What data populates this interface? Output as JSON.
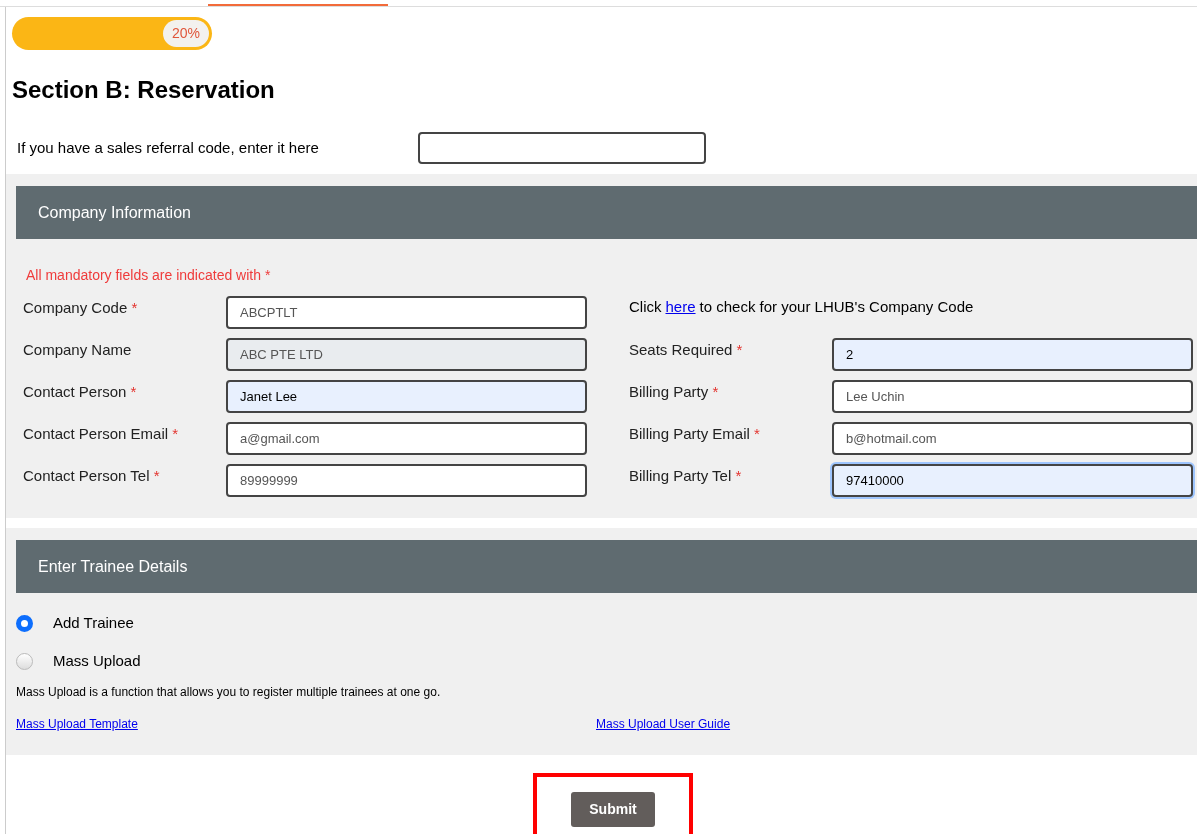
{
  "progress": {
    "level": 0.2,
    "label": "20%"
  },
  "title": "Section B: Reservation",
  "referral": {
    "label": "If you have a sales referral code, enter it here"
  },
  "company_section": {
    "header": "Company Information",
    "note": "All mandatory fields are indicated with *",
    "lookup": {
      "before": "Click",
      "link": "here",
      "after": "to check for your LHUB's Company Code"
    },
    "left_fields": [
      {
        "label": "Company Code",
        "mark": "*",
        "value": "ABCPTLT",
        "disabled": false,
        "autofilled": false,
        "focused": false
      },
      {
        "label": "Company Name",
        "value": "ABC PTE LTD",
        "disabled": true,
        "autofilled": false,
        "focused": false
      },
      {
        "label": "Contact Person",
        "mark": "*",
        "value": "Janet Lee",
        "disabled": false,
        "autofilled": true,
        "focused": false
      },
      {
        "label": "Contact Person Email",
        "mark": "*",
        "value": "a@gmail.com",
        "disabled": false,
        "autofilled": false,
        "focused": false
      },
      {
        "label": "Contact Person Tel",
        "mark": "*",
        "value": "89999999",
        "disabled": false,
        "autofilled": false,
        "focused": false
      }
    ],
    "right_fields": [
      {
        "label": "Seats Required",
        "mark": "*",
        "value": "2",
        "disabled": false,
        "autofilled": true,
        "focused": false
      },
      {
        "label": "Billing Party",
        "mark": "*",
        "value": "Lee Uchin",
        "disabled": false,
        "autofilled": false,
        "focused": false
      },
      {
        "label": "Billing Party Email",
        "mark": "*",
        "value": "b@hotmail.com",
        "disabled": false,
        "autofilled": false,
        "focused": false
      },
      {
        "label": "Billing Party Tel",
        "mark": "*",
        "value": "97410000",
        "disabled": false,
        "autofilled": true,
        "focused": true
      }
    ]
  },
  "trainee_section": {
    "header": "Enter Trainee Details",
    "options": [
      {
        "label": "Add Trainee",
        "selected": true
      },
      {
        "label": "Mass Upload",
        "selected": false
      }
    ],
    "note": "Mass Upload is a function that allows you to register multiple trainees at one go.",
    "links": [
      "Mass Upload Template",
      "Mass Upload User Guide"
    ]
  },
  "submit": {
    "label": "Submit",
    "highlighted": true
  }
}
